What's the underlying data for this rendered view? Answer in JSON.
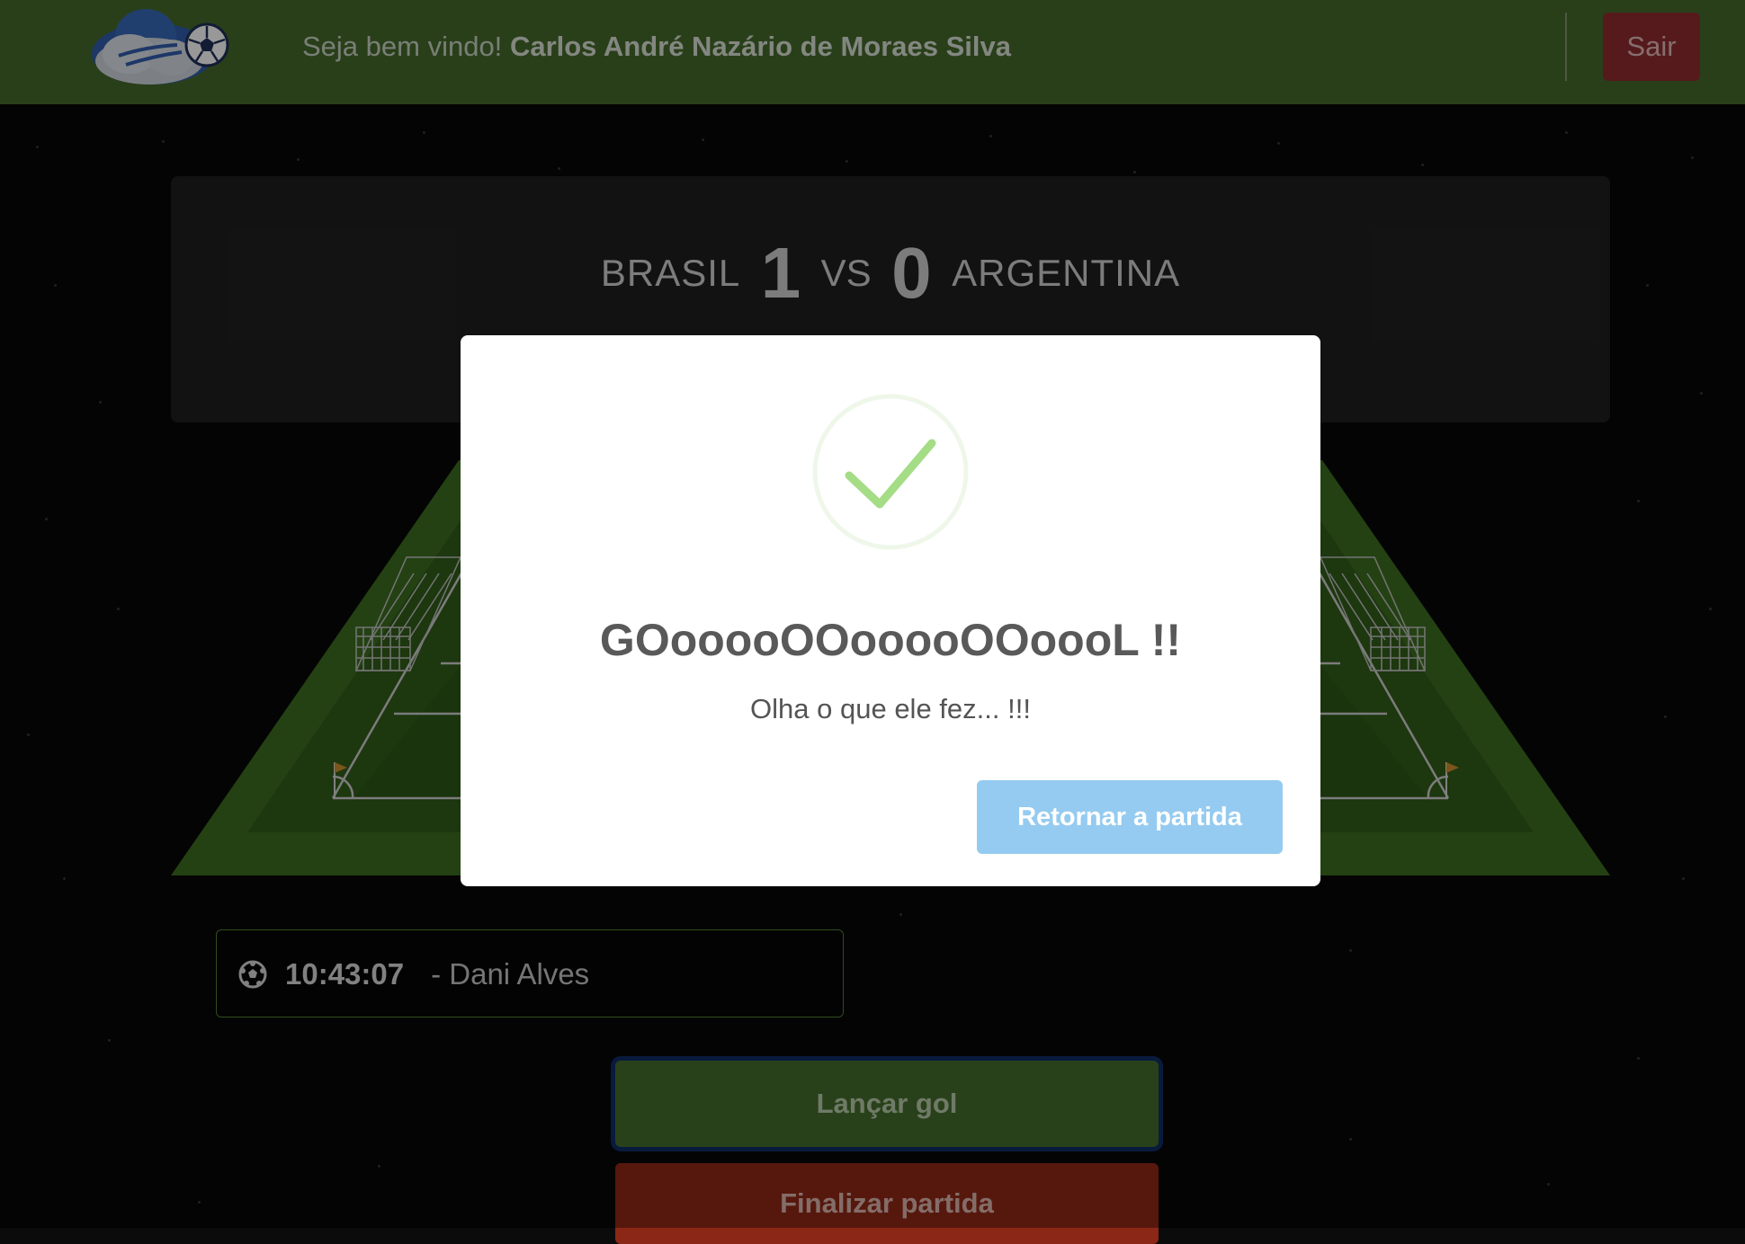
{
  "header": {
    "logo_icon": "cloud-soccer-ball-logo",
    "welcome_prefix": "Seja bem vindo!",
    "user_name": "Carlos André Nazário de Moraes Silva",
    "logout_label": "Sair"
  },
  "scoreboard": {
    "home_team": "BRASIL",
    "home_score": "1",
    "vs": "VS",
    "away_score": "0",
    "away_team": "ARGENTINA"
  },
  "goals": [
    {
      "icon": "soccer-ball-icon",
      "time": "10:43:07",
      "player": "- Dani Alves"
    }
  ],
  "actions": {
    "launch_goal": "Lançar gol",
    "finish_match": "Finalizar partida"
  },
  "modal": {
    "icon": "success-check-icon",
    "title": "GOooooOOooooOOoooL !!",
    "text": "Olha o que ele fez... !!!",
    "button": "Retornar a partida"
  },
  "colors": {
    "header_bg": "#43672a",
    "logout_bg": "#8b2a2e",
    "launch_bg": "#436a2a",
    "finish_bg": "#8b2716",
    "modal_button": "#95cbf0",
    "check_green": "#a5dc86"
  }
}
